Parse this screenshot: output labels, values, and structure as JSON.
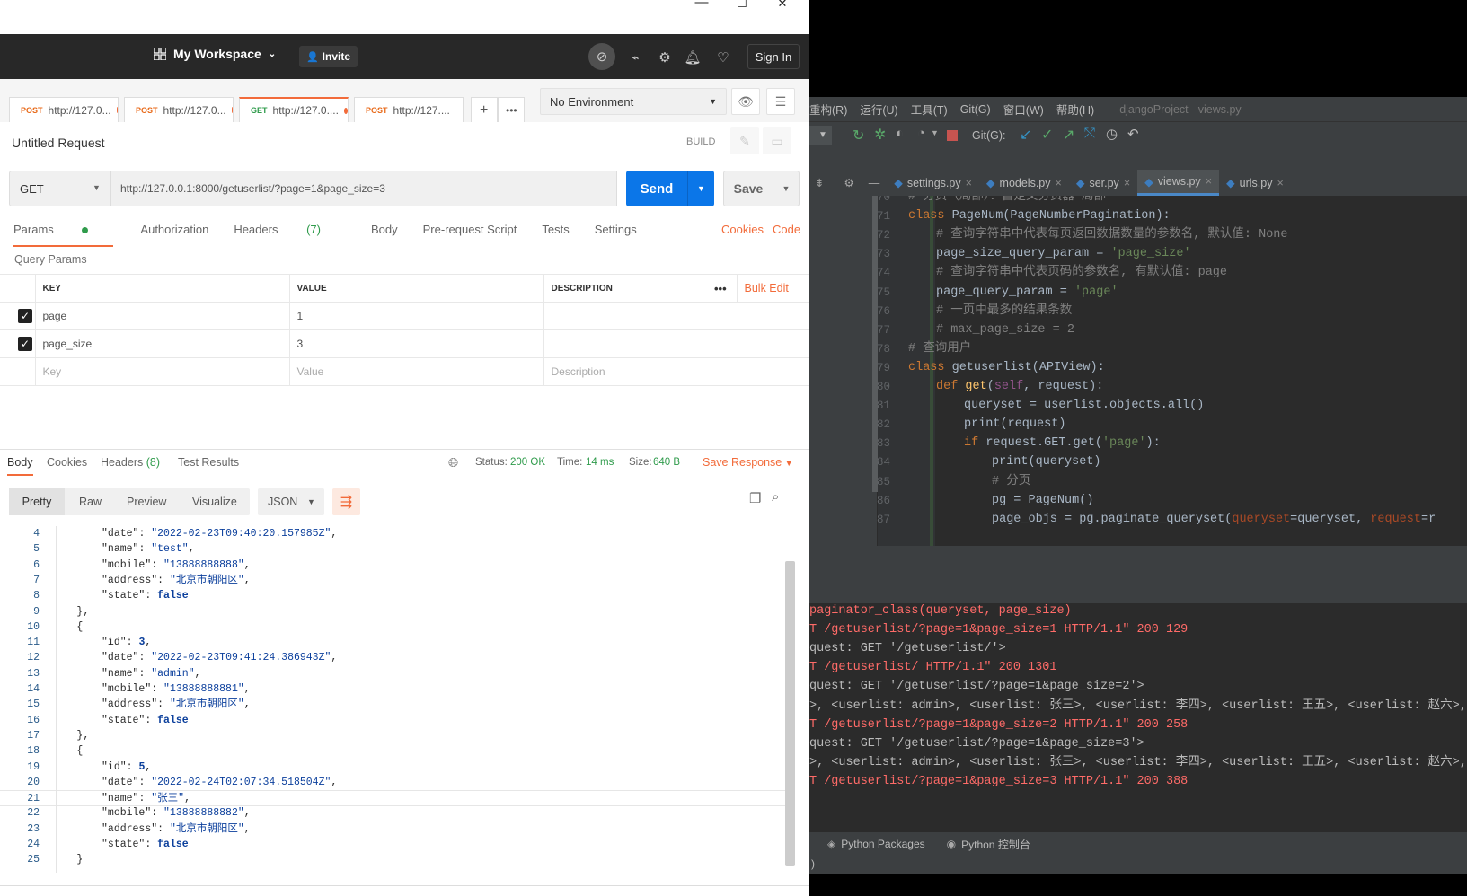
{
  "postman": {
    "window_controls": {
      "minimize": "—",
      "maximize": "☐",
      "close": "✕"
    },
    "header": {
      "workspace": "My Workspace",
      "invite": "Invite",
      "sign_in": "Sign In"
    },
    "tabs": [
      {
        "method": "POST",
        "url": "http://127.0..."
      },
      {
        "method": "POST",
        "url": "http://127.0..."
      },
      {
        "method": "GET",
        "url": "http://127.0...."
      },
      {
        "method": "POST",
        "url": "http://127...."
      }
    ],
    "environment": "No Environment",
    "request_name": "Untitled Request",
    "build_label": "BUILD",
    "method": "GET",
    "url": "http://127.0.0.1:8000/getuserlist/?page=1&page_size=3",
    "send": "Send",
    "save": "Save",
    "request_tabs": {
      "params": "Params",
      "authorization": "Authorization",
      "headers": "Headers",
      "headers_count": "(7)",
      "body": "Body",
      "prerequest": "Pre-request Script",
      "tests": "Tests",
      "settings": "Settings",
      "cookies": "Cookies",
      "code": "Code"
    },
    "query_params_title": "Query Params",
    "params_table": {
      "headers": {
        "key": "KEY",
        "value": "VALUE",
        "description": "DESCRIPTION",
        "bulk_edit": "Bulk Edit"
      },
      "rows": [
        {
          "key": "page",
          "value": "1"
        },
        {
          "key": "page_size",
          "value": "3"
        }
      ],
      "placeholder": {
        "key": "Key",
        "value": "Value",
        "description": "Description"
      }
    },
    "response": {
      "tabs": {
        "body": "Body",
        "cookies": "Cookies",
        "headers": "Headers",
        "headers_count": "(8)",
        "test_results": "Test Results"
      },
      "status_label": "Status:",
      "status": "200 OK",
      "time_label": "Time:",
      "time": "14 ms",
      "size_label": "Size:",
      "size": "640 B",
      "save_response": "Save Response",
      "format_tabs": {
        "pretty": "Pretty",
        "raw": "Raw",
        "preview": "Preview",
        "visualize": "Visualize"
      },
      "format": "JSON"
    },
    "code_lines": [
      {
        "n": "4",
        "indent": 2,
        "k": "\"date\"",
        "v": "\"2022-02-23T09:40:20.157985Z\"",
        "vt": "s",
        "tail": ","
      },
      {
        "n": "5",
        "indent": 2,
        "k": "\"name\"",
        "v": "\"test\"",
        "vt": "s",
        "tail": ","
      },
      {
        "n": "6",
        "indent": 2,
        "k": "\"mobile\"",
        "v": "\"13888888888\"",
        "vt": "s",
        "tail": ","
      },
      {
        "n": "7",
        "indent": 2,
        "k": "\"address\"",
        "v": "\"北京市朝阳区\"",
        "vt": "s",
        "tail": ","
      },
      {
        "n": "8",
        "indent": 2,
        "k": "\"state\"",
        "v": "false",
        "vt": "b",
        "tail": ""
      },
      {
        "n": "9",
        "indent": 1,
        "raw": "},"
      },
      {
        "n": "10",
        "indent": 1,
        "raw": "{"
      },
      {
        "n": "11",
        "indent": 2,
        "k": "\"id\"",
        "v": "3",
        "vt": "b",
        "tail": ","
      },
      {
        "n": "12",
        "indent": 2,
        "k": "\"date\"",
        "v": "\"2022-02-23T09:41:24.386943Z\"",
        "vt": "s",
        "tail": ","
      },
      {
        "n": "13",
        "indent": 2,
        "k": "\"name\"",
        "v": "\"admin\"",
        "vt": "s",
        "tail": ","
      },
      {
        "n": "14",
        "indent": 2,
        "k": "\"mobile\"",
        "v": "\"13888888881\"",
        "vt": "s",
        "tail": ","
      },
      {
        "n": "15",
        "indent": 2,
        "k": "\"address\"",
        "v": "\"北京市朝阳区\"",
        "vt": "s",
        "tail": ","
      },
      {
        "n": "16",
        "indent": 2,
        "k": "\"state\"",
        "v": "false",
        "vt": "b",
        "tail": ""
      },
      {
        "n": "17",
        "indent": 1,
        "raw": "},"
      },
      {
        "n": "18",
        "indent": 1,
        "raw": "{"
      },
      {
        "n": "19",
        "indent": 2,
        "k": "\"id\"",
        "v": "5",
        "vt": "b",
        "tail": ","
      },
      {
        "n": "20",
        "indent": 2,
        "k": "\"date\"",
        "v": "\"2022-02-24T02:07:34.518504Z\"",
        "vt": "s",
        "tail": ","
      },
      {
        "n": "21",
        "indent": 2,
        "k": "\"name\"",
        "v": "\"张三\"",
        "vt": "s",
        "tail": ","
      },
      {
        "n": "22",
        "indent": 2,
        "k": "\"mobile\"",
        "v": "\"13888888882\"",
        "vt": "s",
        "tail": ","
      },
      {
        "n": "23",
        "indent": 2,
        "k": "\"address\"",
        "v": "\"北京市朝阳区\"",
        "vt": "s",
        "tail": ","
      },
      {
        "n": "24",
        "indent": 2,
        "k": "\"state\"",
        "v": "false",
        "vt": "b",
        "tail": ""
      },
      {
        "n": "25",
        "indent": 1,
        "raw": "}"
      }
    ]
  },
  "pycharm": {
    "menu": [
      "重构(R)",
      "运行(U)",
      "工具(T)",
      "Git(G)",
      "窗口(W)",
      "帮助(H)"
    ],
    "title": "djangoProject - views.py",
    "git_label": "Git(G):",
    "file_tabs": [
      "settings.py",
      "models.py",
      "ser.py",
      "views.py",
      "urls.py"
    ],
    "active_tab": "views.py",
    "editor_lines": [
      {
        "n": "70",
        "indent": 0,
        "parts": [
          [
            "cm",
            "# 分页（局部）：自定义分页器 局部"
          ]
        ]
      },
      {
        "n": "71",
        "indent": 0,
        "parts": [
          [
            "kw",
            "class "
          ],
          [
            "tx",
            "PageNum(PageNumberPagination):"
          ]
        ]
      },
      {
        "n": "72",
        "indent": 1,
        "parts": [
          [
            "cm",
            "# 查询字符串中代表每页返回数据数量的参数名, 默认值: None"
          ]
        ]
      },
      {
        "n": "73",
        "indent": 1,
        "parts": [
          [
            "tx",
            "page_size_query_param = "
          ],
          [
            "st",
            "'page_size'"
          ]
        ]
      },
      {
        "n": "74",
        "indent": 1,
        "parts": [
          [
            "cm",
            "# 查询字符串中代表页码的参数名, 有默认值: page"
          ]
        ]
      },
      {
        "n": "75",
        "indent": 1,
        "parts": [
          [
            "tx",
            "page_query_param = "
          ],
          [
            "st",
            "'page'"
          ]
        ]
      },
      {
        "n": "76",
        "indent": 1,
        "parts": [
          [
            "cm",
            "# 一页中最多的结果条数"
          ]
        ]
      },
      {
        "n": "77",
        "indent": 1,
        "parts": [
          [
            "cm",
            "# max_page_size = 2"
          ]
        ]
      },
      {
        "n": "78",
        "indent": 0,
        "parts": [
          [
            "cm",
            "# 查询用户"
          ]
        ]
      },
      {
        "n": "79",
        "indent": 0,
        "parts": [
          [
            "kw",
            "class "
          ],
          [
            "tx",
            "getuserlist(APIView):"
          ]
        ]
      },
      {
        "n": "80",
        "indent": 1,
        "parts": [
          [
            "kw",
            "def "
          ],
          [
            "fn",
            "get"
          ],
          [
            "tx",
            "("
          ],
          [
            "sf",
            "self"
          ],
          [
            "tx",
            ", request):"
          ]
        ]
      },
      {
        "n": "81",
        "indent": 2,
        "parts": [
          [
            "tx",
            "queryset = userlist.objects.all()"
          ]
        ]
      },
      {
        "n": "82",
        "indent": 2,
        "parts": [
          [
            "tx",
            "print(request)"
          ]
        ]
      },
      {
        "n": "83",
        "indent": 2,
        "parts": [
          [
            "kw",
            "if "
          ],
          [
            "tx",
            "request.GET.get("
          ],
          [
            "st",
            "'page'"
          ],
          [
            "tx",
            "):"
          ]
        ]
      },
      {
        "n": "84",
        "indent": 3,
        "parts": [
          [
            "tx",
            "print(queryset)"
          ]
        ]
      },
      {
        "n": "85",
        "indent": 3,
        "parts": [
          [
            "cm",
            "# 分页"
          ]
        ]
      },
      {
        "n": "86",
        "indent": 3,
        "parts": [
          [
            "tx",
            "pg = PageNum()"
          ]
        ]
      },
      {
        "n": "87",
        "indent": 3,
        "parts": [
          [
            "tx",
            "page_objs = pg.paginate_queryset("
          ],
          [
            "pa",
            "queryset"
          ],
          [
            "tx",
            "=queryset, "
          ],
          [
            "pa",
            "request"
          ],
          [
            "tx",
            "=r"
          ]
        ]
      }
    ],
    "console_lines": [
      {
        "c": "red",
        "t": "paginator_class(queryset, page_size)"
      },
      {
        "c": "red",
        "t": "T /getuserlist/?page=1&page_size=1 HTTP/1.1\" 200 129"
      },
      {
        "c": "wht",
        "t": "quest: GET '/getuserlist/'>"
      },
      {
        "c": "red",
        "t": "T /getuserlist/ HTTP/1.1\" 200 1301"
      },
      {
        "c": "wht",
        "t": "quest: GET '/getuserlist/?page=1&page_size=2'>"
      },
      {
        "c": "wht",
        "t": ">, <userlist: admin>, <userlist: 张三>, <userlist: 李四>, <userlist: 王五>, <userlist: 赵六>, <"
      },
      {
        "c": "red",
        "t": "T /getuserlist/?page=1&page_size=2 HTTP/1.1\" 200 258"
      },
      {
        "c": "wht",
        "t": "quest: GET '/getuserlist/?page=1&page_size=3'>"
      },
      {
        "c": "wht",
        "t": ">, <userlist: admin>, <userlist: 张三>, <userlist: 李四>, <userlist: 王五>, <userlist: 赵六>, <"
      },
      {
        "c": "red",
        "t": "T /getuserlist/?page=1&page_size=3 HTTP/1.1\" 200 388"
      }
    ],
    "bottom_tabs": [
      "Python Packages",
      "Python 控制台"
    ],
    "status_text": ")"
  }
}
